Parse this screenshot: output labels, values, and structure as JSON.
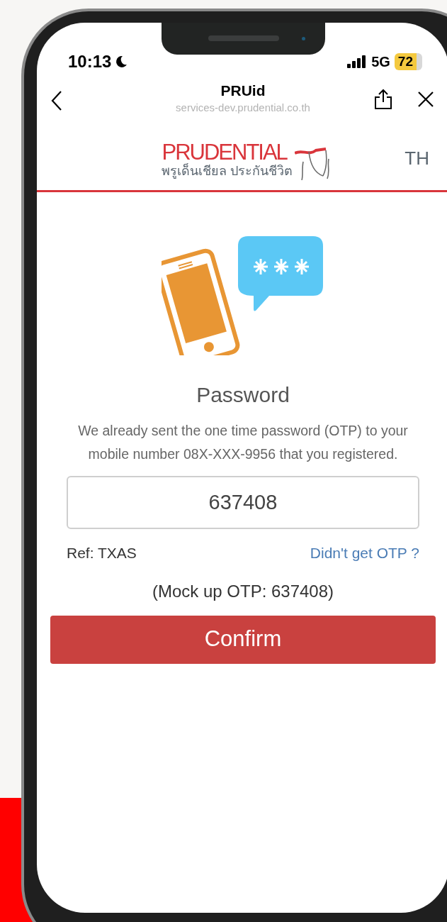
{
  "status_bar": {
    "time": "10:13",
    "network": "5G",
    "battery": "72"
  },
  "browser_bar": {
    "title": "PRUid",
    "url": "services-dev.prudential.co.th"
  },
  "logo": {
    "wordmark": "PRUDENTIAL",
    "tagline": "พรูเด็นเชียล ประกันชีวิต"
  },
  "language": "TH",
  "heading": "Password",
  "description": "We already sent the one time password (OTP) to your mobile number 08X-XXX-9956 that you registered.",
  "otp_field": {
    "value": "637408"
  },
  "reference": "Ref: TXAS",
  "resend_link": "Didn't get OTP ?",
  "mock_note": "(Mock up OTP: 637408)",
  "confirm_button": "Confirm"
}
